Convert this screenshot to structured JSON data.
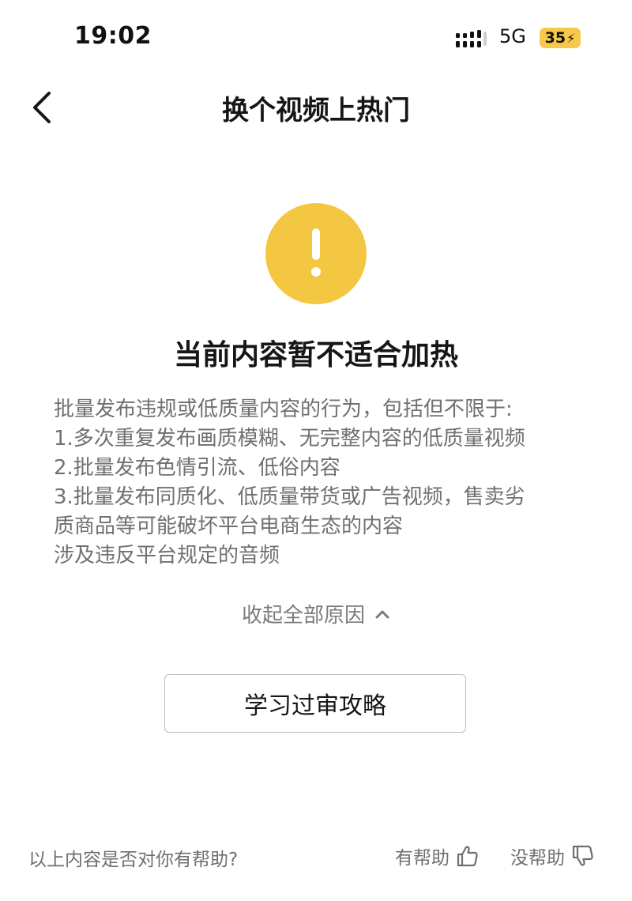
{
  "status_bar": {
    "time": "19:02",
    "network": "5G",
    "battery": "35",
    "battery_color": "#F6C84B"
  },
  "nav": {
    "back_icon": "chevron-left-icon",
    "title": "换个视频上热门"
  },
  "warning": {
    "icon": "exclamation-icon",
    "color": "#F3C742",
    "heading": "当前内容暂不适合加热"
  },
  "reasons": {
    "lines": [
      "批量发布违规或低质量内容的行为，包括但不限于:",
      " 1.多次重复发布画质模糊、无完整内容的低质量视频",
      " 2.批量发布色情引流、低俗内容",
      " 3.批量发布同质化、低质量带货或广告视频，售卖劣",
      "质商品等可能破坏平台电商生态的内容",
      "涉及违反平台规定的音频"
    ],
    "collapse_label": "收起全部原因"
  },
  "study_button": {
    "label": "学习过审攻略"
  },
  "feedback": {
    "question": "以上内容是否对你有帮助?",
    "helpful_label": "有帮助",
    "unhelpful_label": "没帮助"
  }
}
